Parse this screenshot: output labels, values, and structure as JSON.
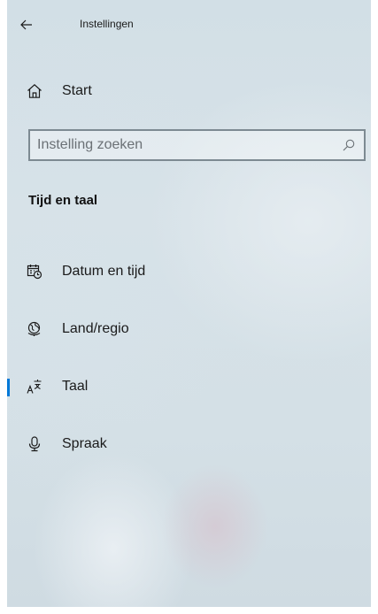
{
  "window": {
    "title": "Instellingen",
    "back_icon": "back-arrow-icon"
  },
  "home": {
    "label": "Start",
    "icon": "home-icon"
  },
  "search": {
    "placeholder": "Instelling zoeken",
    "value": "",
    "icon": "search-icon"
  },
  "section": {
    "title": "Tijd en taal"
  },
  "nav": {
    "items": [
      {
        "label": "Datum en tijd",
        "icon": "calendar-clock-icon",
        "active": false
      },
      {
        "label": "Land/regio",
        "icon": "globe-icon",
        "active": false
      },
      {
        "label": "Taal",
        "icon": "language-icon",
        "active": true
      },
      {
        "label": "Spraak",
        "icon": "microphone-icon",
        "active": false
      }
    ]
  },
  "colors": {
    "accent": "#0078d7",
    "text": "#1a1a1a",
    "search_border": "#7d8a92"
  }
}
